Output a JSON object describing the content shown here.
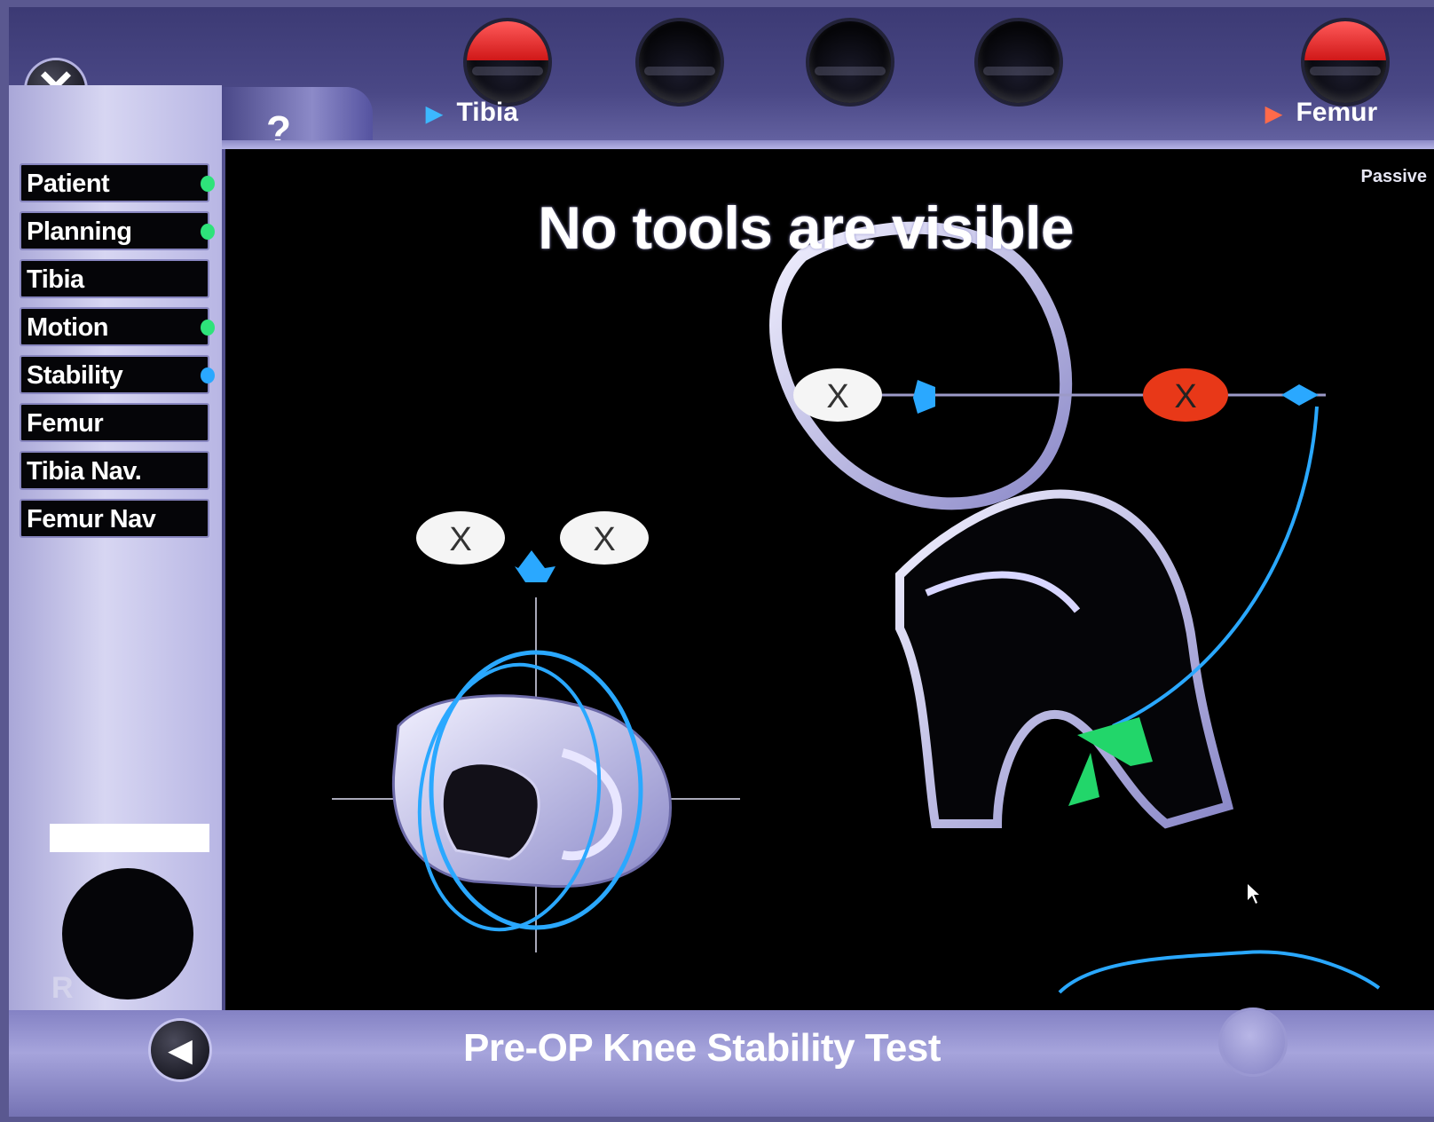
{
  "header": {
    "help_symbol": "?",
    "tabs": [
      {
        "label": "Tibia",
        "arrow": "▶"
      },
      {
        "label": "Femur",
        "arrow": "▶"
      }
    ],
    "close_symbol": "✕"
  },
  "sidebar": {
    "items": [
      {
        "label": "Patient",
        "status_color": "#2ee37a"
      },
      {
        "label": "Planning",
        "status_color": "#2ee37a"
      },
      {
        "label": "Tibia",
        "status_color": ""
      },
      {
        "label": "Motion",
        "status_color": "#2ee37a"
      },
      {
        "label": "Stability",
        "status_color": "#2aa8ff"
      },
      {
        "label": "Femur",
        "status_color": ""
      },
      {
        "label": "Tibia Nav.",
        "status_color": ""
      },
      {
        "label": "Femur Nav",
        "status_color": ""
      }
    ],
    "side_label": "R"
  },
  "main": {
    "headline": "No tools are visible",
    "mode": "Passive",
    "marker_symbol": "X"
  },
  "footer": {
    "title": "Pre-OP Knee Stability Test",
    "back_symbol": "◀"
  },
  "colors": {
    "accent_blue": "#2aa8ff",
    "tracker_green": "#22d66a",
    "marker_red": "#e83818",
    "active_red": "#e02424"
  }
}
